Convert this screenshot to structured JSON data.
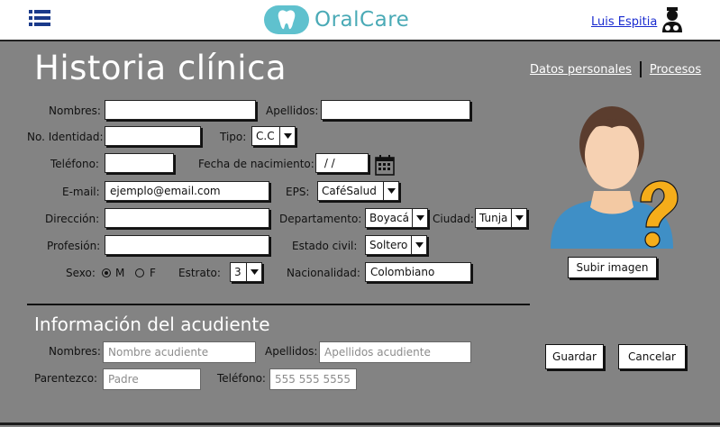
{
  "header": {
    "menu_icon": "hamburger-menu-icon",
    "logo_text": "OralCare",
    "logo_icon": "tooth-icon",
    "brand_color": "#5fc1ce",
    "user_name": "Luis Espitia",
    "user_icon": "user-doctor-icon"
  },
  "page": {
    "title": "Historia clínica",
    "links": [
      "Datos personales",
      "Procesos"
    ],
    "background": "#838383"
  },
  "form": {
    "nombres": {
      "label": "Nombres:",
      "value": ""
    },
    "apellidos": {
      "label": "Apellidos:",
      "value": ""
    },
    "identidad": {
      "label": "No. Identidad:",
      "value": ""
    },
    "tipo": {
      "label": "Tipo:",
      "value": "C.C"
    },
    "telefono": {
      "label": "Teléfono:",
      "value": ""
    },
    "fecha_nacimiento": {
      "label": "Fecha de nacimiento:",
      "value": " / /"
    },
    "email": {
      "label": "E-mail:",
      "value": "ejemplo@email.com"
    },
    "eps": {
      "label": "EPS:",
      "value": "CaféSalud"
    },
    "direccion": {
      "label": "Dirección:",
      "value": ""
    },
    "departamento": {
      "label": "Departamento:",
      "value": "Boyacá"
    },
    "ciudad": {
      "label": "Ciudad:",
      "value": "Tunja"
    },
    "profesion": {
      "label": "Profesión:",
      "value": ""
    },
    "estado_civil": {
      "label": "Estado civil:",
      "value": "Soltero"
    },
    "sexo": {
      "label": "Sexo:",
      "options": [
        "M",
        "F"
      ],
      "selected": "M"
    },
    "estrato": {
      "label": "Estrato:",
      "value": "3"
    },
    "nacionalidad": {
      "label": "Nacionalidad:",
      "value": "Colombiano"
    }
  },
  "photo": {
    "icon": "user-unknown-avatar-icon",
    "upload_button": "Subir imagen"
  },
  "guardian": {
    "title": "Información del acudiente",
    "nombres": {
      "label": "Nombres:",
      "placeholder": "Nombre acudiente"
    },
    "apellidos": {
      "label": "Apellidos:",
      "placeholder": "Apellidos acudiente"
    },
    "parentezco": {
      "label": "Parentezco:",
      "placeholder": "Padre"
    },
    "telefono": {
      "label": "Teléfono:",
      "placeholder": "555 555 5555"
    }
  },
  "actions": {
    "save": "Guardar",
    "cancel": "Cancelar"
  }
}
